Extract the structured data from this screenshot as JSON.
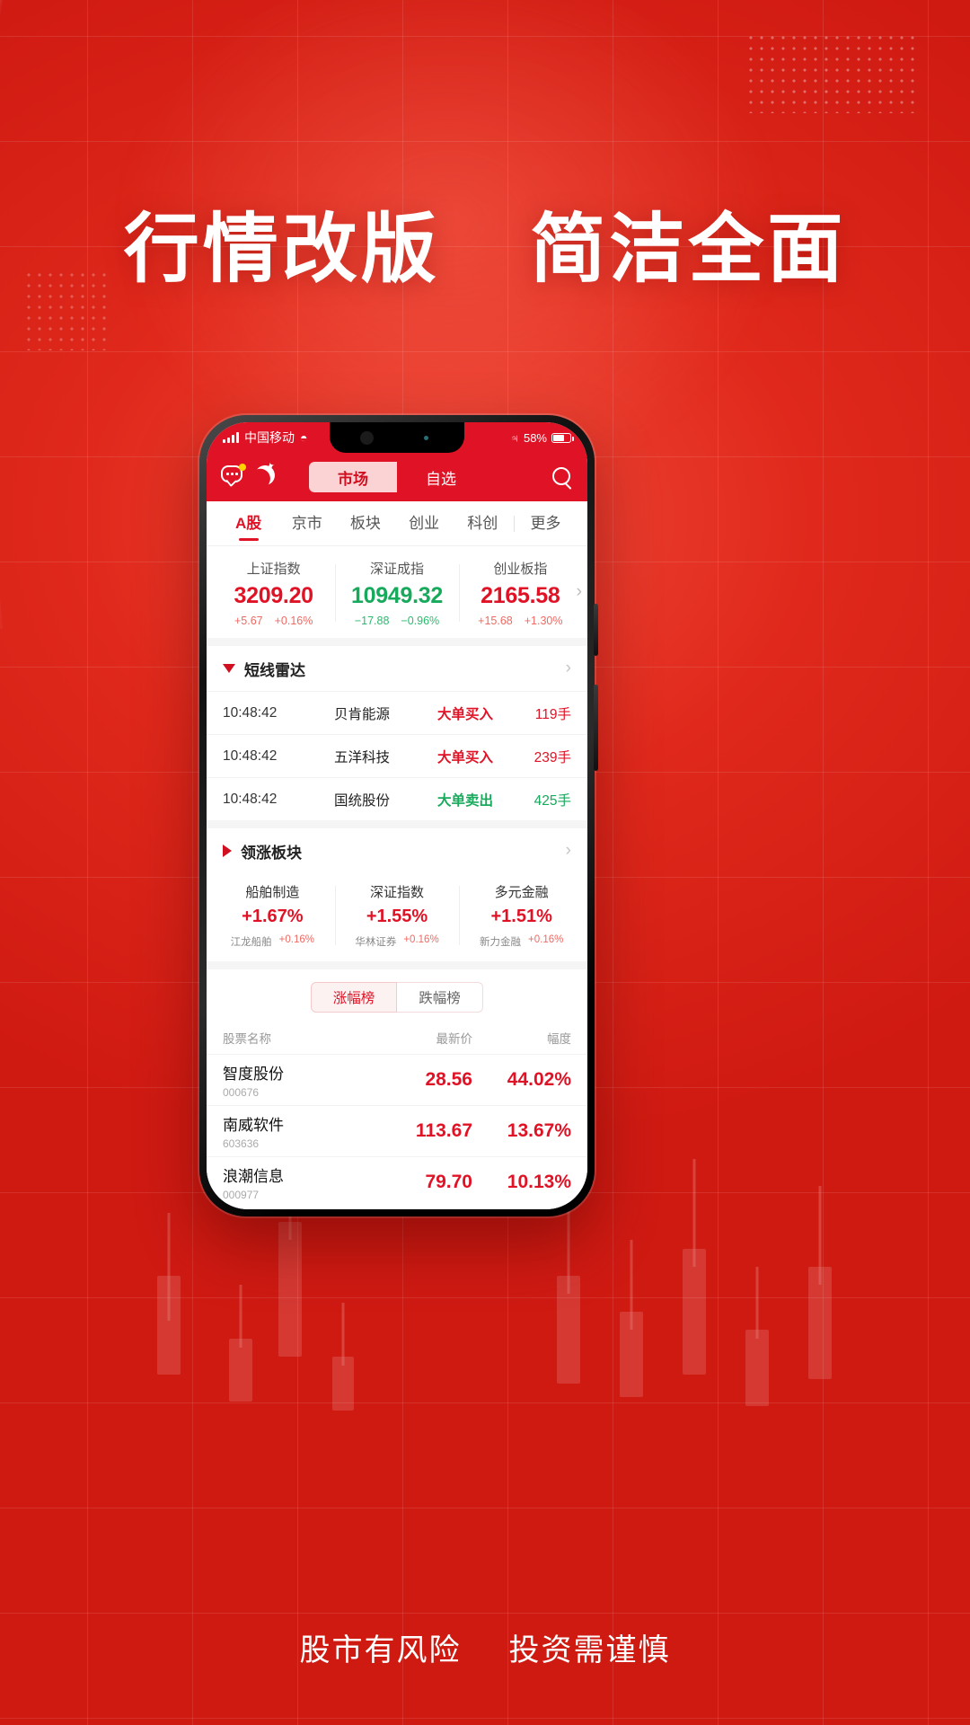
{
  "poster": {
    "headline_left": "行情改版",
    "headline_right": "简洁全面",
    "footer_left": "股市有风险",
    "footer_right": "投资需谨慎"
  },
  "status_bar": {
    "carrier": "中国移动",
    "battery": "58%",
    "wifi_icon": "wifi-icon",
    "bluetooth_icon": "bluetooth-icon",
    "signal_icon": "signal-bars-icon"
  },
  "top_nav": {
    "chat_icon": "chat-icon",
    "moon_icon": "moon-icon",
    "search_icon": "search-icon",
    "tabs": [
      {
        "label": "市场",
        "active": true
      },
      {
        "label": "自选",
        "active": false
      }
    ]
  },
  "categories": [
    {
      "label": "A股",
      "active": true
    },
    {
      "label": "京市",
      "active": false
    },
    {
      "label": "板块",
      "active": false
    },
    {
      "label": "创业",
      "active": false
    },
    {
      "label": "科创",
      "active": false
    },
    {
      "label": "更多",
      "active": false
    }
  ],
  "indices": [
    {
      "name": "上证指数",
      "value": "3209.20",
      "change": "+5.67",
      "pct": "+0.16%",
      "dir": "up"
    },
    {
      "name": "深证成指",
      "value": "10949.32",
      "change": "−17.88",
      "pct": "−0.96%",
      "dir": "down"
    },
    {
      "name": "创业板指",
      "value": "2165.58",
      "change": "+15.68",
      "pct": "+1.30%",
      "dir": "up"
    }
  ],
  "radar": {
    "title": "短线雷达",
    "rows": [
      {
        "time": "10:48:42",
        "name": "贝肯能源",
        "action": "大单买入",
        "dir": "up",
        "volume": "119手"
      },
      {
        "time": "10:48:42",
        "name": "五洋科技",
        "action": "大单买入",
        "dir": "up",
        "volume": "239手"
      },
      {
        "time": "10:48:42",
        "name": "国统股份",
        "action": "大单卖出",
        "dir": "down",
        "volume": "425手"
      }
    ]
  },
  "sectors": {
    "title": "领涨板块",
    "items": [
      {
        "name": "船舶制造",
        "pct": "+1.67%",
        "stock": "江龙船舶",
        "stock_pct": "+0.16%"
      },
      {
        "name": "深证指数",
        "pct": "+1.55%",
        "stock": "华林证券",
        "stock_pct": "+0.16%"
      },
      {
        "name": "多元金融",
        "pct": "+1.51%",
        "stock": "新力金融",
        "stock_pct": "+0.16%"
      }
    ]
  },
  "rank": {
    "tabs": [
      {
        "label": "涨幅榜",
        "active": true
      },
      {
        "label": "跌幅榜",
        "active": false
      }
    ],
    "headers": {
      "name": "股票名称",
      "price": "最新价",
      "pct": "幅度"
    },
    "rows": [
      {
        "name": "智度股份",
        "code": "000676",
        "price": "28.56",
        "pct": "44.02%"
      },
      {
        "name": "南威软件",
        "code": "603636",
        "price": "113.67",
        "pct": "13.67%"
      },
      {
        "name": "浪潮信息",
        "code": "000977",
        "price": "79.70",
        "pct": "10.13%"
      }
    ]
  },
  "colors": {
    "brand_red": "#e01326",
    "up_red": "#e01326",
    "down_green": "#17a95c",
    "bg_red": "#d92014"
  }
}
